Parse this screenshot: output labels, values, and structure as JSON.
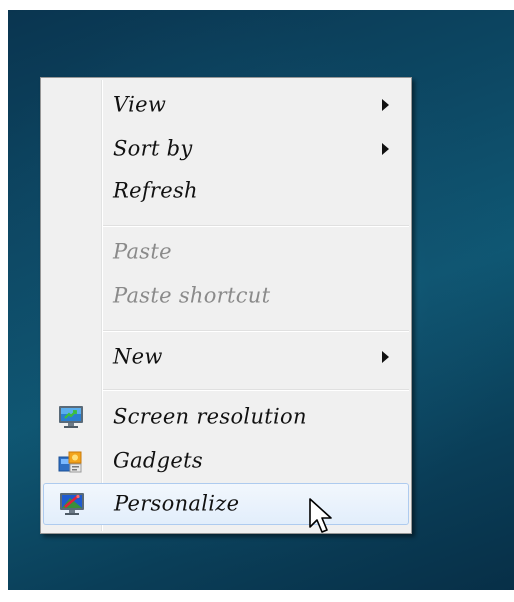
{
  "menu": {
    "items": [
      {
        "label": "View",
        "submenu": true,
        "enabled": true
      },
      {
        "label": "Sort by",
        "submenu": true,
        "enabled": true
      },
      {
        "label": "Refresh",
        "submenu": false,
        "enabled": true
      },
      {
        "label": "Paste",
        "submenu": false,
        "enabled": false
      },
      {
        "label": "Paste shortcut",
        "submenu": false,
        "enabled": false
      },
      {
        "label": "New",
        "submenu": true,
        "enabled": true
      },
      {
        "label": "Screen resolution",
        "submenu": false,
        "enabled": true,
        "icon": "display-settings-icon"
      },
      {
        "label": "Gadgets",
        "submenu": false,
        "enabled": true,
        "icon": "gadgets-icon"
      },
      {
        "label": "Personalize",
        "submenu": false,
        "enabled": true,
        "icon": "personalize-icon",
        "highlighted": true
      }
    ]
  },
  "colors": {
    "desktop": "#0d4a66",
    "menu_background": "#f0f0f0",
    "menu_border": "#979797",
    "disabled_text": "#8a8a8a",
    "highlight_border": "#aecbef"
  }
}
